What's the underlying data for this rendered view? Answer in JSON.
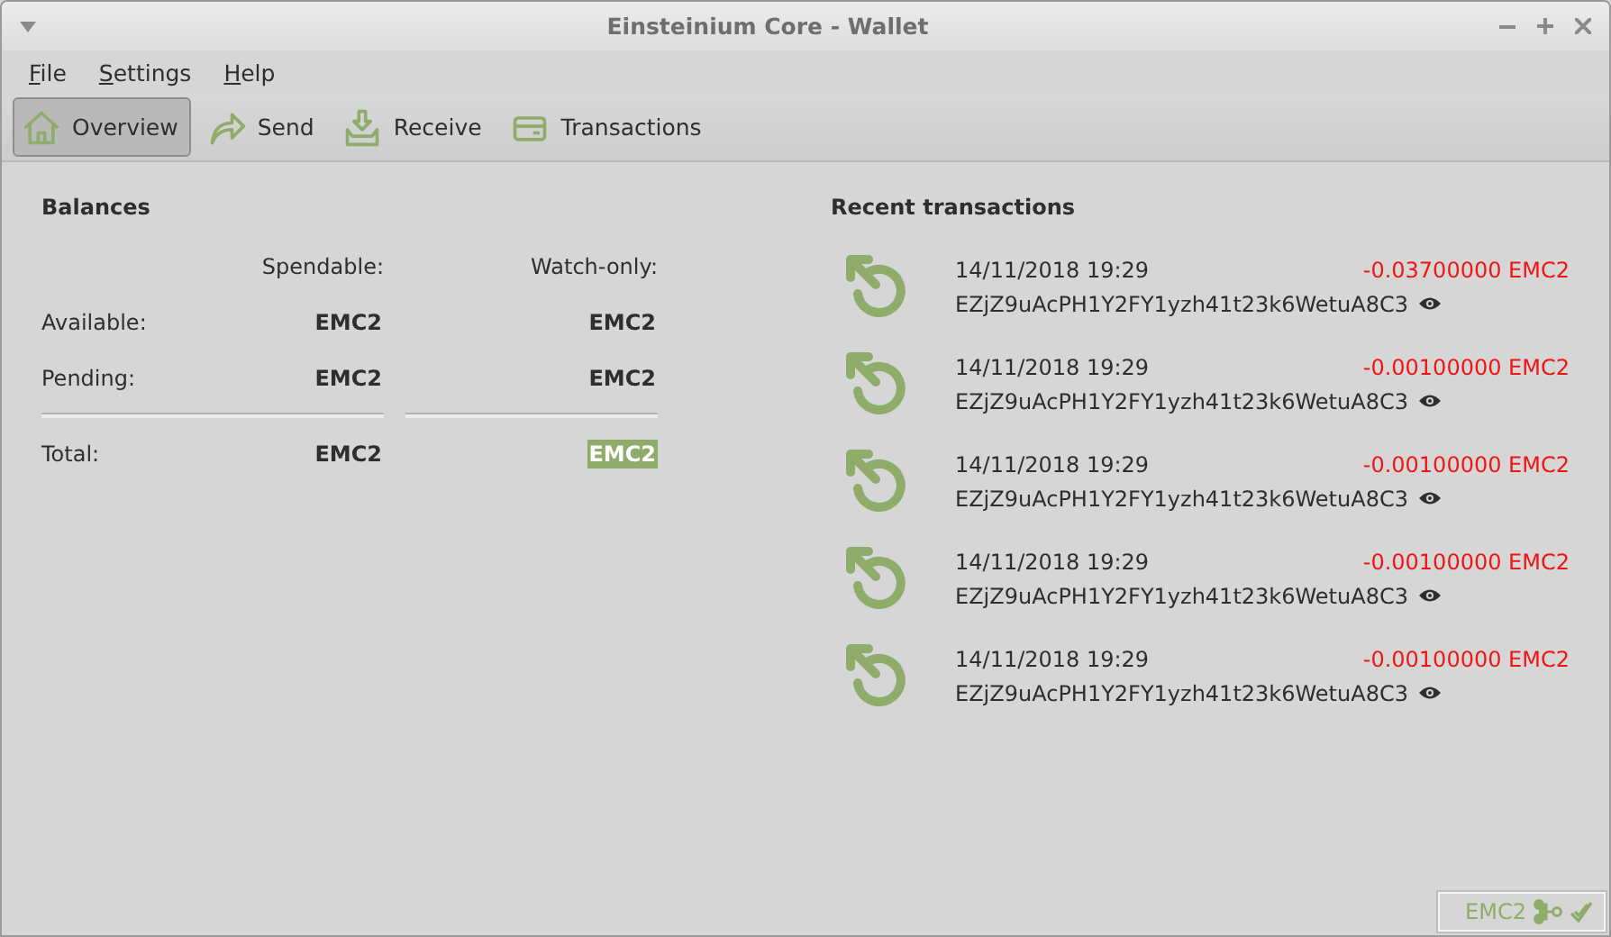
{
  "window": {
    "title": "Einsteinium Core - Wallet"
  },
  "menu": [
    {
      "mnemonic": "F",
      "rest": "ile"
    },
    {
      "mnemonic": "S",
      "rest": "ettings"
    },
    {
      "mnemonic": "H",
      "rest": "elp"
    }
  ],
  "toolbar": [
    {
      "label": "Overview",
      "kind": "home",
      "selected": true
    },
    {
      "label": "Send",
      "kind": "send",
      "selected": false
    },
    {
      "label": "Receive",
      "kind": "receive",
      "selected": false
    },
    {
      "label": "Transactions",
      "kind": "transactions",
      "selected": false
    }
  ],
  "balances": {
    "title": "Balances",
    "spendable_header": "Spendable:",
    "watch_header": "Watch-only:",
    "rows": [
      {
        "label": "Available:",
        "spendable": "EMC2",
        "watch": "EMC2",
        "highlighted": false,
        "separator_before": false
      },
      {
        "label": "Pending:",
        "spendable": "EMC2",
        "watch": "EMC2",
        "highlighted": false,
        "separator_before": false
      },
      {
        "label": "Total:",
        "spendable": "EMC2",
        "watch": "EMC2",
        "highlighted": true,
        "separator_before": true
      }
    ]
  },
  "recent": {
    "title": "Recent transactions",
    "items": [
      {
        "date": "14/11/2018 19:29",
        "amount": "-0.03700000 EMC2",
        "address": "EZjZ9uAcPH1Y2FY1yzh41t23k6WetuA8C3",
        "watch_only": true
      },
      {
        "date": "14/11/2018 19:29",
        "amount": "-0.00100000 EMC2",
        "address": "EZjZ9uAcPH1Y2FY1yzh41t23k6WetuA8C3",
        "watch_only": true
      },
      {
        "date": "14/11/2018 19:29",
        "amount": "-0.00100000 EMC2",
        "address": "EZjZ9uAcPH1Y2FY1yzh41t23k6WetuA8C3",
        "watch_only": true
      },
      {
        "date": "14/11/2018 19:29",
        "amount": "-0.00100000 EMC2",
        "address": "EZjZ9uAcPH1Y2FY1yzh41t23k6WetuA8C3",
        "watch_only": true
      },
      {
        "date": "14/11/2018 19:29",
        "amount": "-0.00100000 EMC2",
        "address": "EZjZ9uAcPH1Y2FY1yzh41t23k6WetuA8C3",
        "watch_only": true
      }
    ]
  },
  "status_bar": {
    "unit": "EMC2"
  }
}
